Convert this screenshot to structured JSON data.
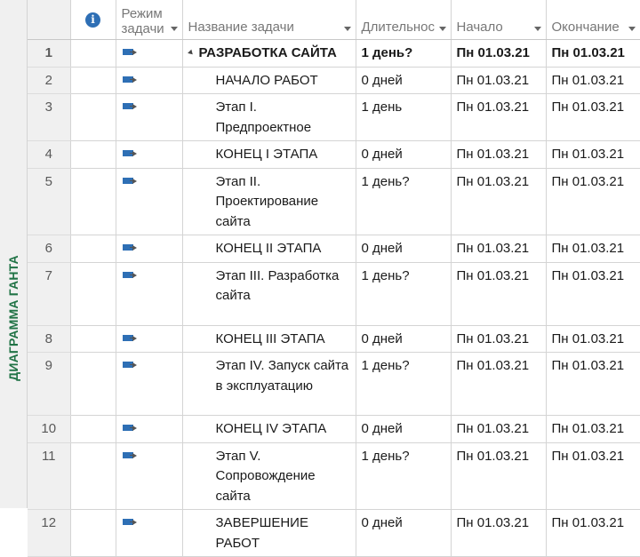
{
  "view_label": "ДИАГРАММА ГАНТА",
  "columns": {
    "info_icon": "info-icon",
    "mode_line1": "Режим",
    "mode_line2": "задачи",
    "name": "Название задачи",
    "duration": "Длительнос",
    "start": "Начало",
    "finish": "Окончание"
  },
  "tasks": [
    {
      "id": "1",
      "name": "РАЗРАБОТКА САЙТА",
      "duration": "1 день?",
      "start": "Пн 01.03.21",
      "finish": "Пн 01.03.21",
      "summary": true
    },
    {
      "id": "2",
      "name": "НАЧАЛО РАБОТ",
      "duration": "0 дней",
      "start": "Пн 01.03.21",
      "finish": "Пн 01.03.21"
    },
    {
      "id": "3",
      "name": "Этап I. Предпроектное",
      "duration": "1 день",
      "start": "Пн 01.03.21",
      "finish": "Пн 01.03.21"
    },
    {
      "id": "4",
      "name": "КОНЕЦ I ЭТАПА",
      "duration": "0 дней",
      "start": "Пн 01.03.21",
      "finish": "Пн 01.03.21"
    },
    {
      "id": "5",
      "name": "Этап II. Проектирование сайта",
      "duration": "1 день?",
      "start": "Пн 01.03.21",
      "finish": "Пн 01.03.21"
    },
    {
      "id": "6",
      "name": "КОНЕЦ II ЭТАПА",
      "duration": "0 дней",
      "start": "Пн 01.03.21",
      "finish": "Пн 01.03.21"
    },
    {
      "id": "7",
      "name": "Этап III. Разработка сайта",
      "duration": "1 день?",
      "start": "Пн 01.03.21",
      "finish": "Пн 01.03.21"
    },
    {
      "id": "8",
      "name": "КОНЕЦ III ЭТАПА",
      "duration": "0 дней",
      "start": "Пн 01.03.21",
      "finish": "Пн 01.03.21"
    },
    {
      "id": "9",
      "name": "Этап IV. Запуск сайта в эксплуатацию",
      "duration": "1 день?",
      "start": "Пн 01.03.21",
      "finish": "Пн 01.03.21"
    },
    {
      "id": "10",
      "name": "КОНЕЦ IV ЭТАПА",
      "duration": "0 дней",
      "start": "Пн 01.03.21",
      "finish": "Пн 01.03.21"
    },
    {
      "id": "11",
      "name": "Этап V. Сопровождение сайта",
      "duration": "1 день?",
      "start": "Пн 01.03.21",
      "finish": "Пн 01.03.21"
    },
    {
      "id": "12",
      "name": "ЗАВЕРШЕНИЕ РАБОТ",
      "duration": "0 дней",
      "start": "Пн 01.03.21",
      "finish": "Пн 01.03.21"
    }
  ],
  "colors": {
    "view_label": "#217346",
    "info_icon": "#2e6fb5",
    "task_mode_icon": "#2e6fb5",
    "header_text": "#777777"
  }
}
